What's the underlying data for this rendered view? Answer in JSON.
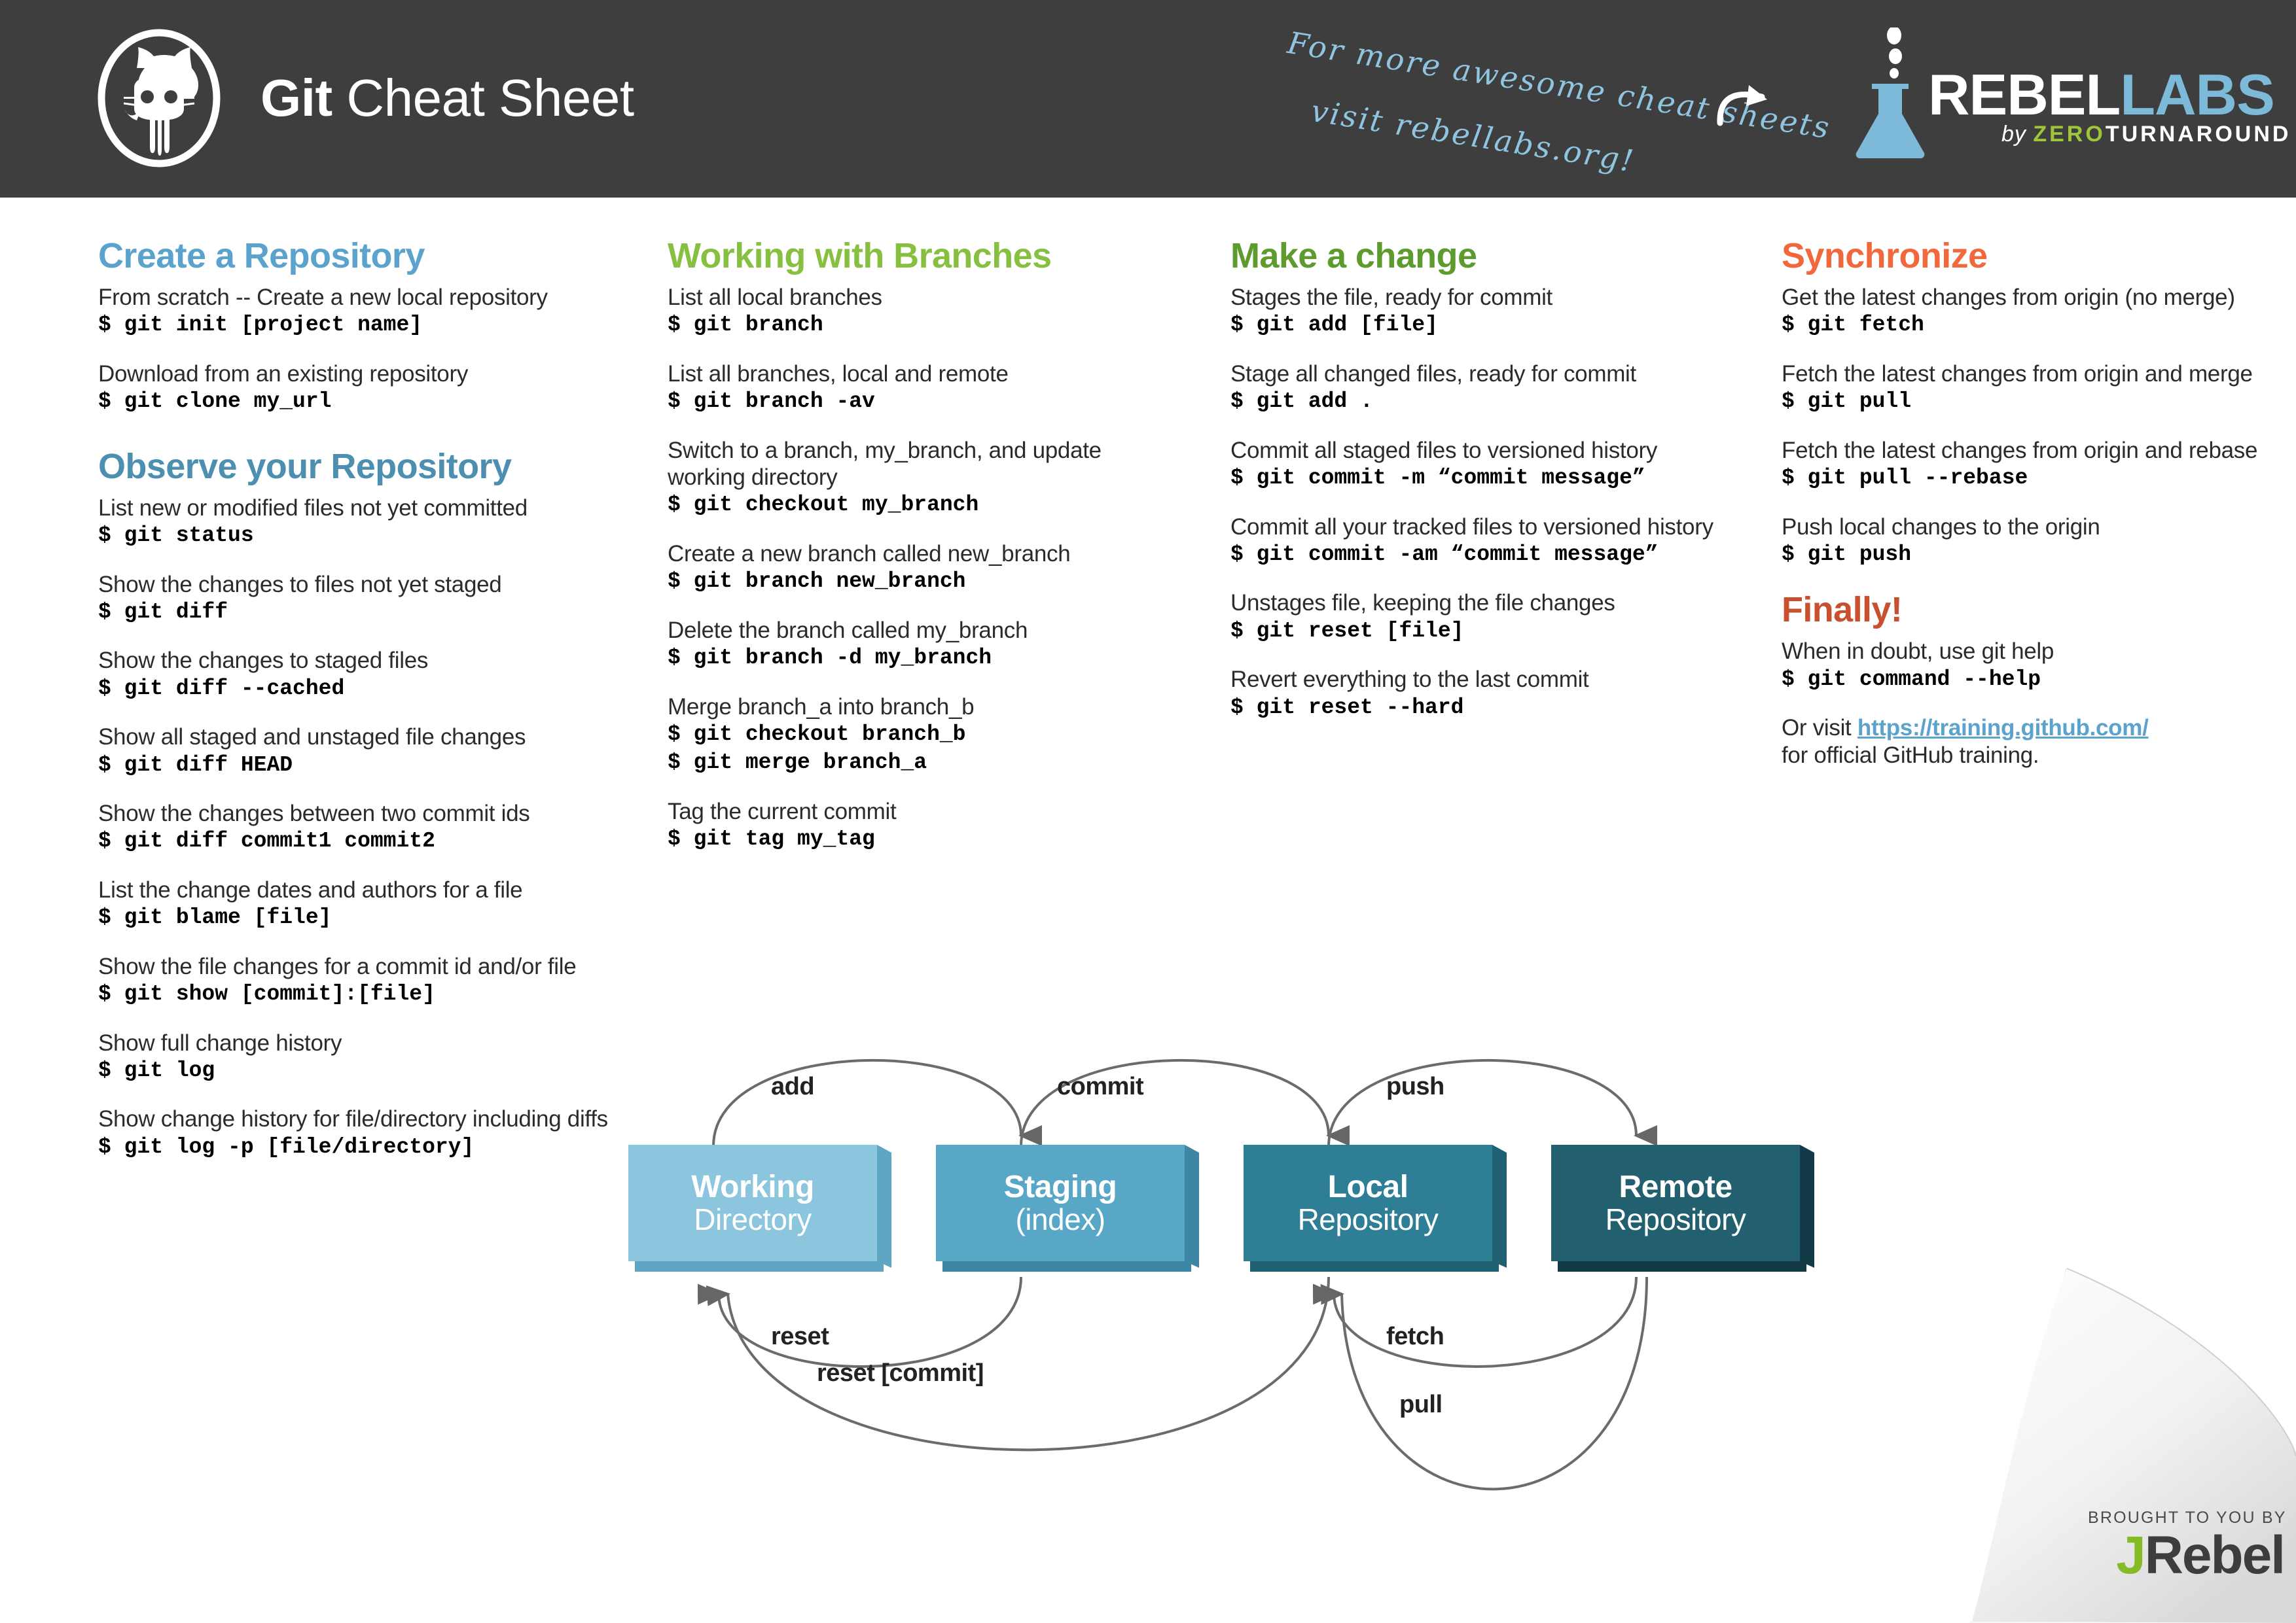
{
  "header": {
    "title_bold": "Git",
    "title_light": " Cheat Sheet",
    "handwritten_line1": "For more awesome cheat sheets",
    "handwritten_line2": "visit rebellabs.org!",
    "logo_rebel": "REBEL",
    "logo_labs": "LABS",
    "logo_by": "by ",
    "logo_zero": "ZERO",
    "logo_turnaround": "TURNAROUND",
    "bg_color": "#3e3e3e"
  },
  "columns": [
    {
      "sections": [
        {
          "heading": "Create a Repository",
          "color": "#5ba3cc",
          "entries": [
            {
              "desc": "From scratch -- Create a new local repository",
              "cmds": [
                "$ git init [project name]"
              ]
            },
            {
              "desc": "Download from an existing repository",
              "cmds": [
                "$ git clone my_url"
              ]
            }
          ]
        },
        {
          "heading": "Observe your Repository",
          "color": "#4c8fb0",
          "entries": [
            {
              "desc": "List new or modified files not yet committed",
              "cmds": [
                "$ git status"
              ]
            },
            {
              "desc": "Show the changes to files not yet staged",
              "cmds": [
                "$ git diff"
              ]
            },
            {
              "desc": "Show the changes to staged files",
              "cmds": [
                "$ git diff --cached"
              ]
            },
            {
              "desc": "Show all staged and unstaged file changes",
              "cmds": [
                "$ git diff HEAD"
              ]
            },
            {
              "desc": "Show the changes between two commit ids",
              "cmds": [
                "$ git diff commit1 commit2"
              ]
            },
            {
              "desc": "List the change dates and authors for a file",
              "cmds": [
                "$ git blame [file]"
              ]
            },
            {
              "desc": "Show the file changes for a commit id and/or file",
              "cmds": [
                "$ git show [commit]:[file]"
              ]
            },
            {
              "desc": "Show full change history",
              "cmds": [
                "$ git log"
              ]
            },
            {
              "desc": "Show change history for file/directory including diffs",
              "cmds": [
                "$ git log -p [file/directory]"
              ]
            }
          ]
        }
      ]
    },
    {
      "sections": [
        {
          "heading": "Working with Branches",
          "color": "#87c040",
          "entries": [
            {
              "desc": "List all local branches",
              "cmds": [
                "$ git branch"
              ]
            },
            {
              "desc": "List all branches, local and remote",
              "cmds": [
                "$ git branch -av"
              ]
            },
            {
              "desc": "Switch to a branch, my_branch, and update working directory",
              "cmds": [
                "$ git checkout my_branch"
              ]
            },
            {
              "desc": "Create a new branch called new_branch",
              "cmds": [
                "$ git branch new_branch"
              ]
            },
            {
              "desc": "Delete the branch called my_branch",
              "cmds": [
                "$ git branch -d my_branch"
              ]
            },
            {
              "desc": "Merge branch_a into branch_b",
              "cmds": [
                "$ git checkout branch_b",
                "$ git merge branch_a"
              ]
            },
            {
              "desc": "Tag the current commit",
              "cmds": [
                "$ git tag my_tag"
              ]
            }
          ]
        }
      ]
    },
    {
      "sections": [
        {
          "heading": "Make a change",
          "color": "#5d9b2f",
          "entries": [
            {
              "desc": "Stages the file, ready for commit",
              "cmds": [
                "$ git add [file]"
              ]
            },
            {
              "desc": "Stage all changed files, ready for commit",
              "cmds": [
                "$ git add ."
              ]
            },
            {
              "desc": "Commit all staged files to versioned history",
              "cmds": [
                "$ git commit -m “commit message”"
              ]
            },
            {
              "desc": "Commit all your tracked files to versioned history",
              "cmds": [
                "$ git commit -am “commit message”"
              ]
            },
            {
              "desc": "Unstages file, keeping the file changes",
              "cmds": [
                "$ git reset [file]"
              ]
            },
            {
              "desc": "Revert everything to the last commit",
              "cmds": [
                "$ git reset --hard"
              ]
            }
          ]
        }
      ]
    },
    {
      "sections": [
        {
          "heading": "Synchronize",
          "color": "#f0683c",
          "entries": [
            {
              "desc": "Get the latest changes from origin (no merge)",
              "cmds": [
                "$ git fetch"
              ]
            },
            {
              "desc": "Fetch the latest changes from origin and merge",
              "cmds": [
                "$ git pull"
              ]
            },
            {
              "desc": "Fetch the latest changes from origin and rebase",
              "cmds": [
                "$ git pull --rebase"
              ]
            },
            {
              "desc": "Push local changes to the origin",
              "cmds": [
                "$ git push"
              ]
            }
          ]
        },
        {
          "heading": "Finally!",
          "color": "#c8502e",
          "entries": [
            {
              "desc": "When in doubt, use git help",
              "cmds": [
                "$ git command --help"
              ]
            }
          ],
          "outro_pre": "Or visit ",
          "outro_link": "https://training.github.com/",
          "outro_post": "for official GitHub training."
        }
      ]
    }
  ],
  "diagram": {
    "boxes": [
      {
        "title": "Working",
        "subtitle": "Directory",
        "face": "#8bc5de",
        "side": "#5fa5c4",
        "bottom": "#5fa5c4"
      },
      {
        "title": "Staging",
        "subtitle": "(index)",
        "face": "#59a7c6",
        "side": "#3d87a5",
        "bottom": "#3d87a5"
      },
      {
        "title": "Local",
        "subtitle": "Repository",
        "face": "#2e7e96",
        "side": "#1f6073",
        "bottom": "#1f6073"
      },
      {
        "title": "Remote",
        "subtitle": "Repository",
        "face": "#23606f",
        "side": "#123b47",
        "bottom": "#123b47"
      }
    ],
    "labels": {
      "add": "add",
      "commit": "commit",
      "push": "push",
      "reset": "reset",
      "reset_commit": "reset [commit]",
      "fetch": "fetch",
      "pull": "pull"
    }
  },
  "footer": {
    "brought_to_you_by": "BROUGHT TO YOU BY",
    "logo_j": "J",
    "logo_rebel": "Rebel"
  }
}
